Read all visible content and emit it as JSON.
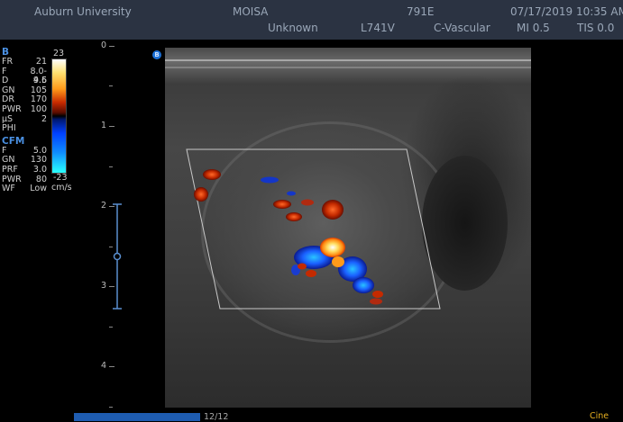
{
  "header": {
    "institution": "Auburn University",
    "operator": "MOISA",
    "patient_id": "791E",
    "datetime": "07/17/2019 10:35 AM",
    "patient_name": "Unknown",
    "probe": "L741V",
    "preset": "C-Vascular",
    "mi": "MI 0.5",
    "tis": "TIS 0.0"
  },
  "b_mode": {
    "title": "B",
    "params": [
      {
        "k": "FR",
        "v": "21"
      },
      {
        "k": "F",
        "v": "8.0-9.6"
      },
      {
        "k": "D",
        "v": "4.5"
      },
      {
        "k": "GN",
        "v": "105"
      },
      {
        "k": "DR",
        "v": "170"
      },
      {
        "k": "PWR",
        "v": "100"
      },
      {
        "k": "µS",
        "v": "2"
      },
      {
        "k": "PHI",
        "v": ""
      }
    ]
  },
  "cfm": {
    "title": "CFM",
    "params": [
      {
        "k": "F",
        "v": "5.0"
      },
      {
        "k": "GN",
        "v": "130"
      },
      {
        "k": "PRF",
        "v": "3.0"
      },
      {
        "k": "PWR",
        "v": "80"
      },
      {
        "k": "WF",
        "v": "Low"
      }
    ]
  },
  "colorbar": {
    "top": "23",
    "bottom": "-23",
    "unit": "cm/s"
  },
  "depth_labels": [
    "0",
    "1",
    "2",
    "3",
    "4"
  ],
  "probe_marker": "B",
  "cine": {
    "frame": "12/12",
    "label": "Cine",
    "progress": 1.0
  }
}
